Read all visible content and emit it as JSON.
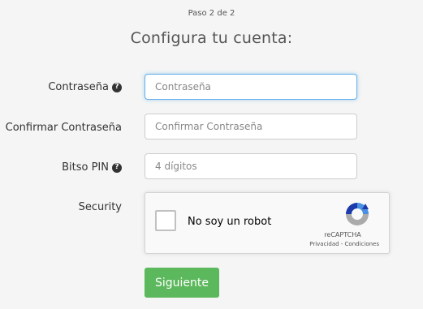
{
  "header": {
    "step": "Paso 2 de 2",
    "title": "Configura tu cuenta:"
  },
  "form": {
    "password": {
      "label": "Contraseña",
      "placeholder": "Contraseña",
      "help_icon": "question-circle-icon"
    },
    "confirm_password": {
      "label": "Confirmar Contraseña",
      "placeholder": "Confirmar Contraseña"
    },
    "pin": {
      "label": "Bitso PIN",
      "placeholder": "4 dígitos",
      "help_icon": "question-circle-icon"
    },
    "security": {
      "label": "Security"
    }
  },
  "captcha": {
    "checkbox_label": "No soy un robot",
    "brand": "reCAPTCHA",
    "links": "Privacidad - Condiciones",
    "logo_icon": "recaptcha-logo-icon"
  },
  "submit": {
    "label": "Siguiente",
    "color": "#5cb85c"
  },
  "colors": {
    "focus_border": "#66afe9",
    "background": "#f4f5f4"
  }
}
